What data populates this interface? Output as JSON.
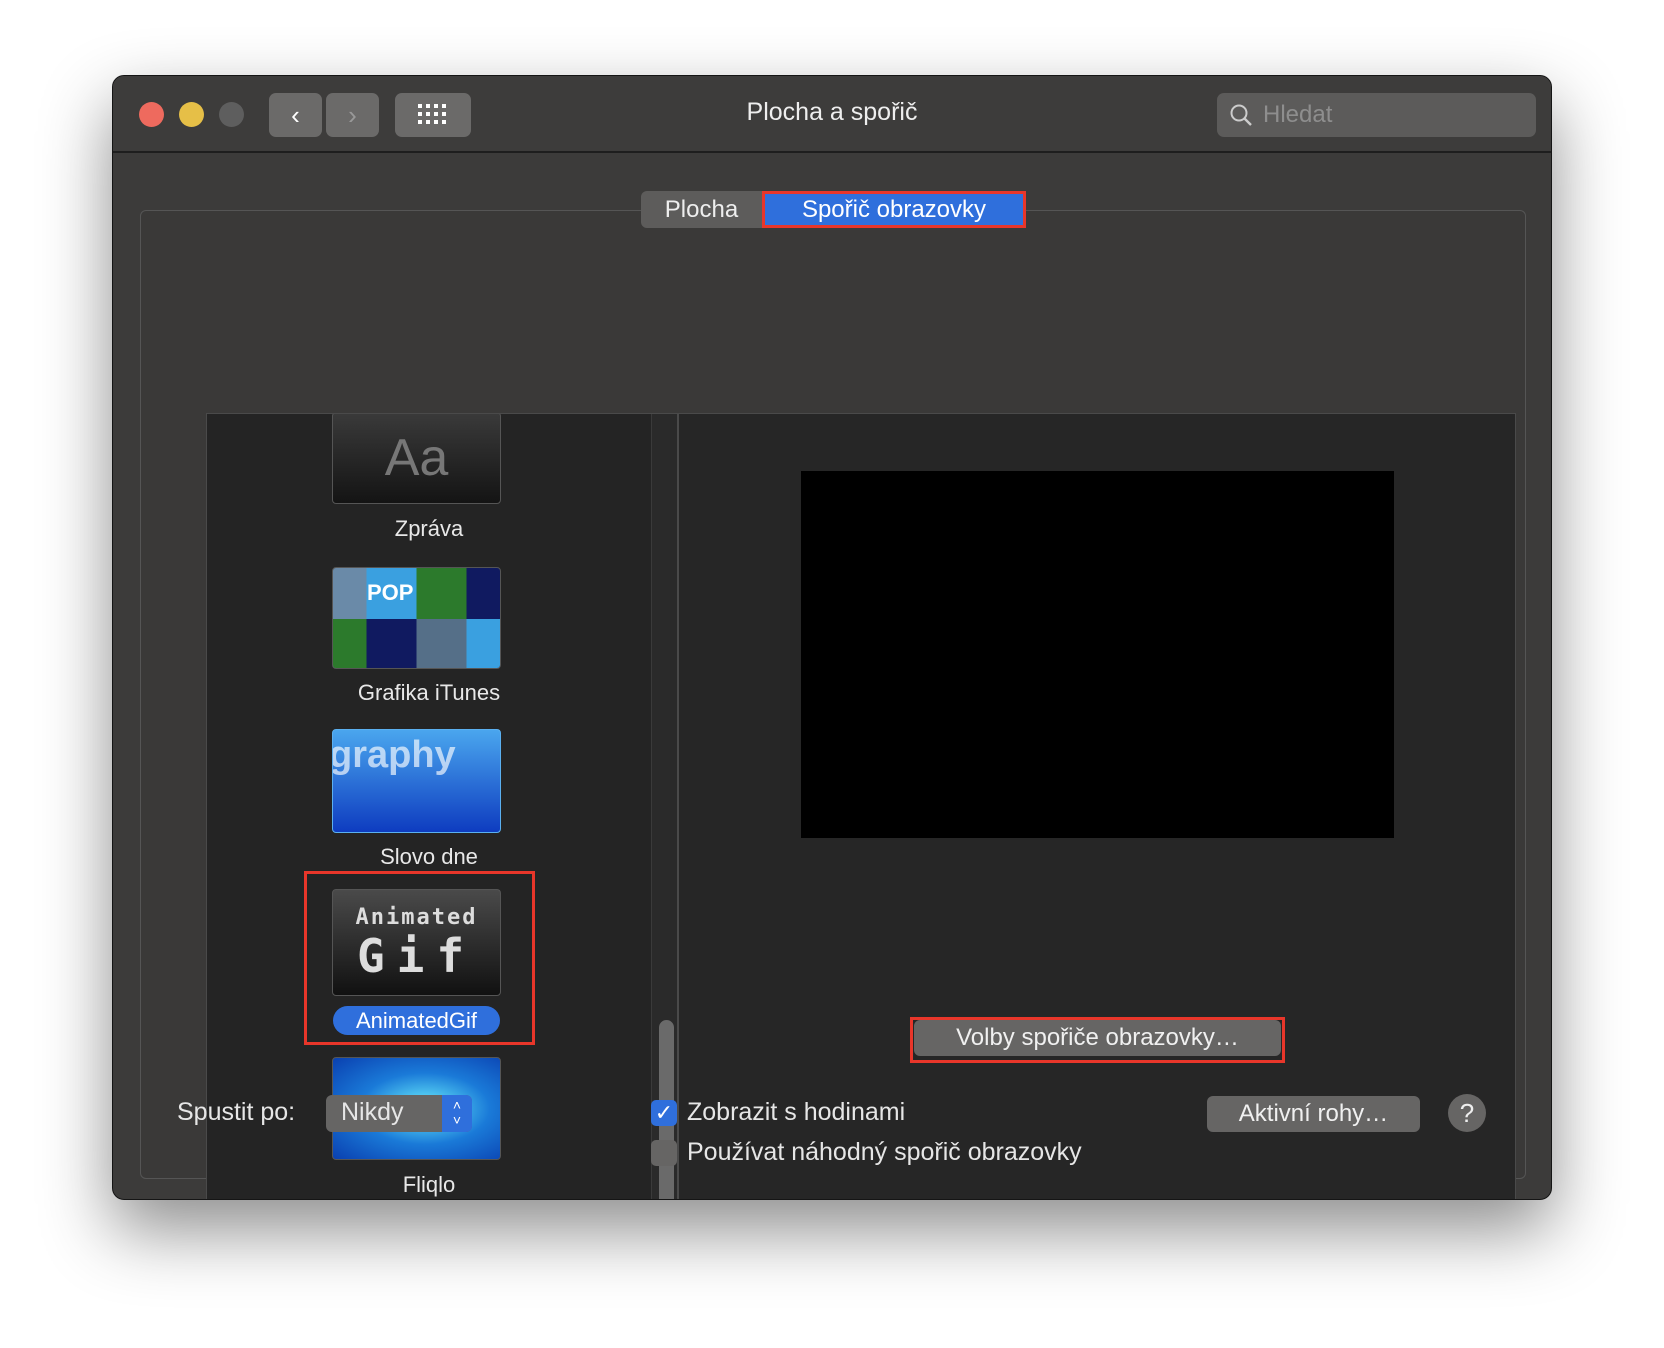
{
  "window": {
    "title": "Plocha a spořič"
  },
  "toolbar": {
    "back": "‹",
    "forward": "›",
    "search_placeholder": "Hledat"
  },
  "tabs": [
    {
      "label": "Plocha",
      "selected": false
    },
    {
      "label": "Spořič obrazovky",
      "selected": true
    }
  ],
  "savers": [
    {
      "label": "Zpráva",
      "thumb_text": "Aa"
    },
    {
      "label": "Grafika iTunes",
      "thumb_text": "POP"
    },
    {
      "label": "Slovo dne",
      "thumb_text": "graphy"
    },
    {
      "label": "AnimatedGif",
      "thumb_text": "Animated Gif",
      "selected": true
    },
    {
      "label": "Fliqlo"
    }
  ],
  "options_button": "Volby spořiče obrazovky…",
  "bottom": {
    "start_after_label": "Spustit po:",
    "start_after_value": "Nikdy",
    "show_clock_label": "Zobrazit s hodinami",
    "show_clock_checked": true,
    "random_label": "Používat náhodný spořič obrazovky",
    "random_checked": false,
    "hot_corners": "Aktivní rohy…",
    "help": "?"
  },
  "colors": {
    "accent": "#2f6fdc",
    "highlight": "#e8362a"
  }
}
